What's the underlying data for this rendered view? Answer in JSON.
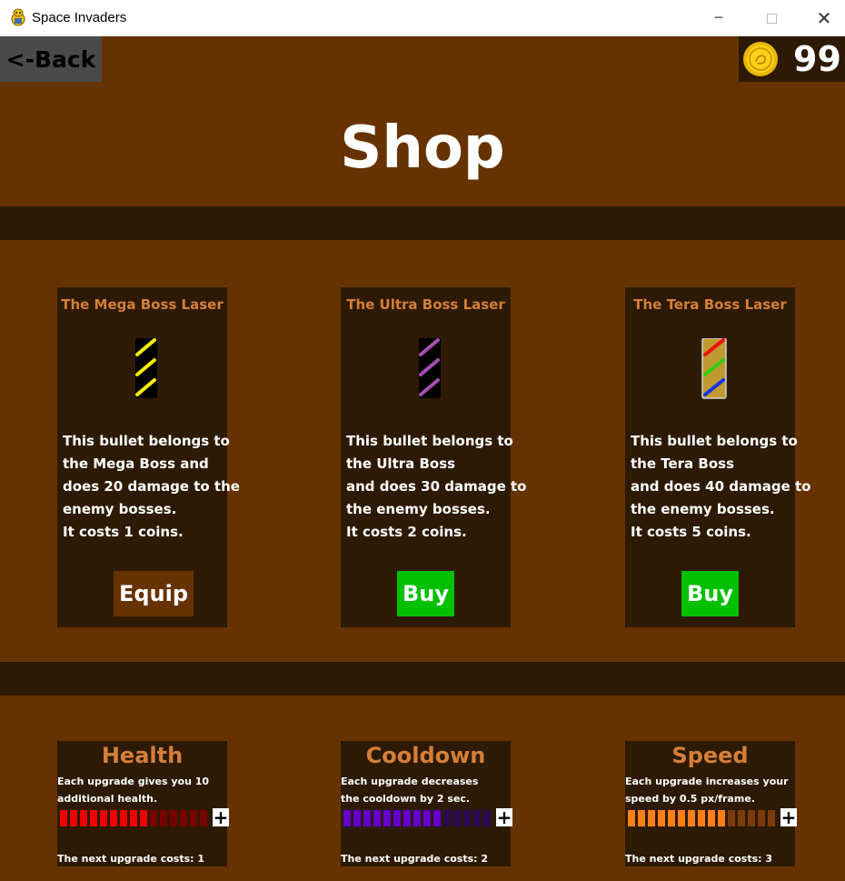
{
  "window": {
    "title": "Space Invaders",
    "minimize_label": "─",
    "close_label": "✕"
  },
  "header": {
    "back_label": "<-Back",
    "coin_count": "99",
    "coin_icon": "gold-coin-icon"
  },
  "page_title": "Shop",
  "lasers": [
    {
      "name": "The Mega Boss Laser",
      "description": "This bullet belongs to\nthe Mega Boss and\ndoes 20 damage to the\nenemy bosses.\nIt costs 1 coins.",
      "button_label": "Equip",
      "button_color": "#663300",
      "stripe_colors": [
        "#ffee00"
      ]
    },
    {
      "name": "The Ultra Boss Laser",
      "description": "This bullet belongs to\nthe Ultra Boss\nand does 30 damage to\nthe enemy bosses.\nIt costs 2 coins.",
      "button_label": "Buy",
      "button_color": "#00c000",
      "stripe_colors": [
        "#a34fb0"
      ]
    },
    {
      "name": "The Tera Boss Laser",
      "description": "This bullet belongs to\nthe Tera Boss\nand does 40 damage to\nthe enemy bosses.\nIt costs 5 coins.",
      "button_label": "Buy",
      "button_color": "#00c000",
      "stripe_colors": [
        "#ee1111",
        "#33cc11",
        "#1133ee"
      ]
    }
  ],
  "upgrades": [
    {
      "name": "Health",
      "description": "Each upgrade gives you 10\nadditional health.",
      "cost_text": "The next upgrade costs: 1",
      "plus_label": "+",
      "level": 9,
      "max_level": 15,
      "filled_color": "#ee0000",
      "empty_color": "#770000"
    },
    {
      "name": "Cooldown",
      "description": "Each upgrade decreases\nthe cooldown by 2 sec.",
      "cost_text": "The next upgrade costs: 2",
      "plus_label": "+",
      "level": 10,
      "max_level": 15,
      "filled_color": "#6600cc",
      "empty_color": "#2a0a55"
    },
    {
      "name": "Speed",
      "description": "Each upgrade increases your\nspeed by 0.5 px/frame.",
      "cost_text": "The next upgrade costs: 3",
      "plus_label": "+",
      "level": 10,
      "max_level": 15,
      "filled_color": "#ff7f1a",
      "empty_color": "#7a3a0a"
    }
  ]
}
